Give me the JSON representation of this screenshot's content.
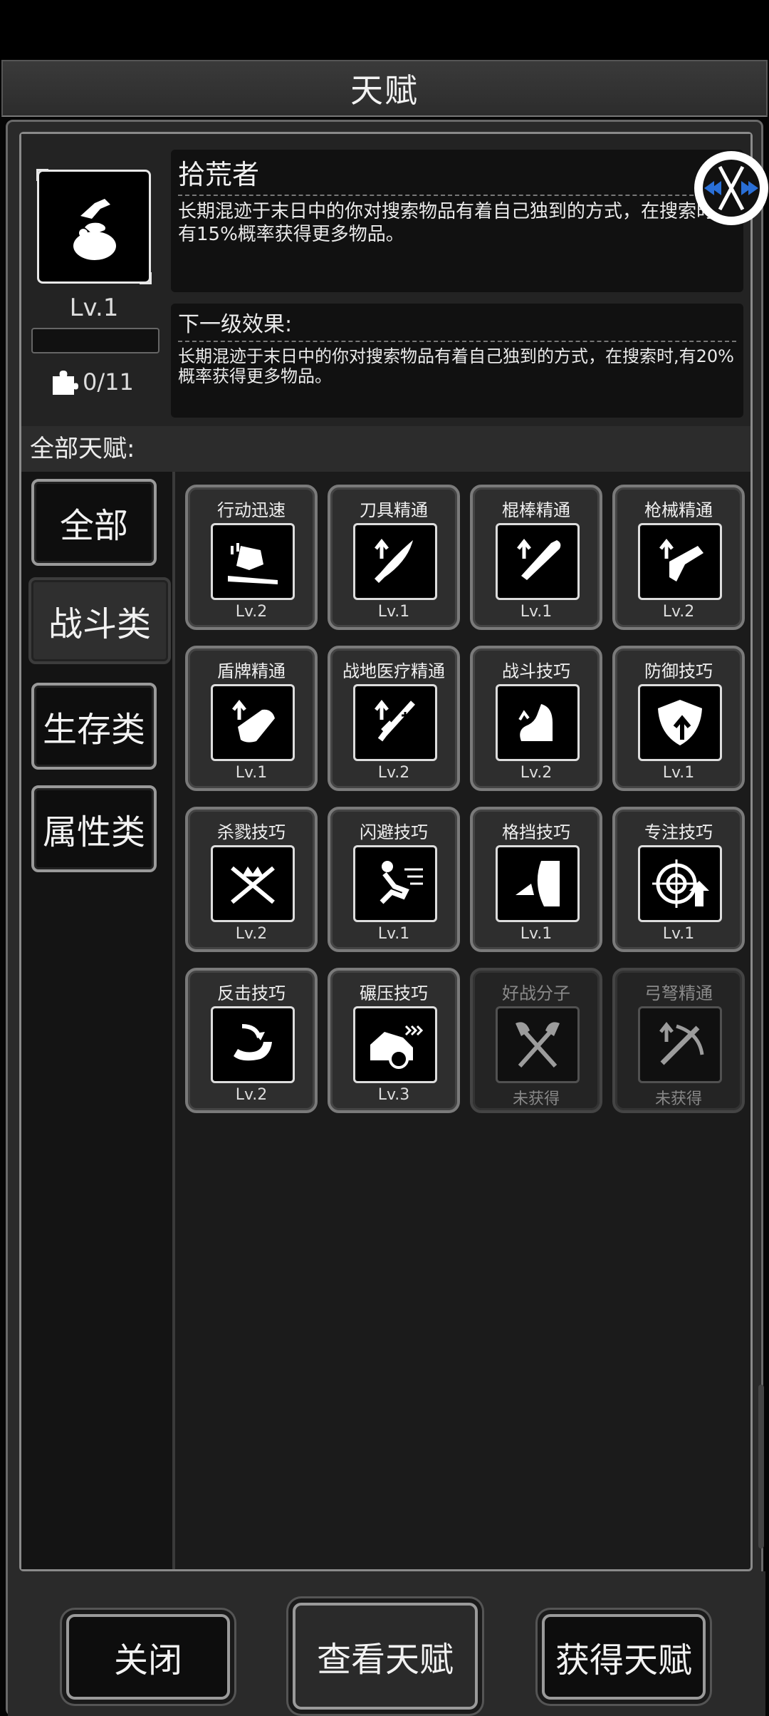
{
  "window": {
    "title": "天赋"
  },
  "selected": {
    "name": "拾荒者",
    "level": "Lv.1",
    "pieces": "0/11",
    "description": "长期混迹于末日中的你对搜索物品有着自己独到的方式，在搜索时,有15%概率获得更多物品。",
    "next_title": "下一级效果:",
    "next_description": "长期混迹于末日中的你对搜索物品有着自己独到的方式，在搜索时,有20%概率获得更多物品。"
  },
  "section_label": "全部天赋:",
  "categories": [
    {
      "label": "全部"
    },
    {
      "label": "战斗类"
    },
    {
      "label": "生存类"
    },
    {
      "label": "属性类"
    }
  ],
  "talents": [
    {
      "name": "行动迅速",
      "level": "Lv.2",
      "icon": "run-icon"
    },
    {
      "name": "刀具精通",
      "level": "Lv.1",
      "icon": "machete-icon"
    },
    {
      "name": "棍棒精通",
      "level": "Lv.1",
      "icon": "bat-icon"
    },
    {
      "name": "枪械精通",
      "level": "Lv.2",
      "icon": "pistol-icon"
    },
    {
      "name": "盾牌精通",
      "level": "Lv.1",
      "icon": "shield-arm-icon"
    },
    {
      "name": "战地医疗精通",
      "level": "Lv.2",
      "icon": "syringe-icon"
    },
    {
      "name": "战斗技巧",
      "level": "Lv.2",
      "icon": "flex-arm-icon"
    },
    {
      "name": "防御技巧",
      "level": "Lv.1",
      "icon": "shield-up-icon"
    },
    {
      "name": "杀戮技巧",
      "level": "Lv.2",
      "icon": "crossed-blades-icon"
    },
    {
      "name": "闪避技巧",
      "level": "Lv.1",
      "icon": "dodge-icon"
    },
    {
      "name": "格挡技巧",
      "level": "Lv.1",
      "icon": "block-icon"
    },
    {
      "name": "专注技巧",
      "level": "Lv.1",
      "icon": "target-icon"
    },
    {
      "name": "反击技巧",
      "level": "Lv.2",
      "icon": "counter-arm-icon"
    },
    {
      "name": "碾压技巧",
      "level": "Lv.3",
      "icon": "car-crush-icon"
    },
    {
      "name": "好战分子",
      "level": "未获得",
      "icon": "crossed-axes-icon"
    },
    {
      "name": "弓弩精通",
      "level": "未获得",
      "icon": "crossbow-icon"
    }
  ],
  "buttons": {
    "close": "关闭",
    "view": "查看天赋",
    "obtain": "获得天赋"
  }
}
